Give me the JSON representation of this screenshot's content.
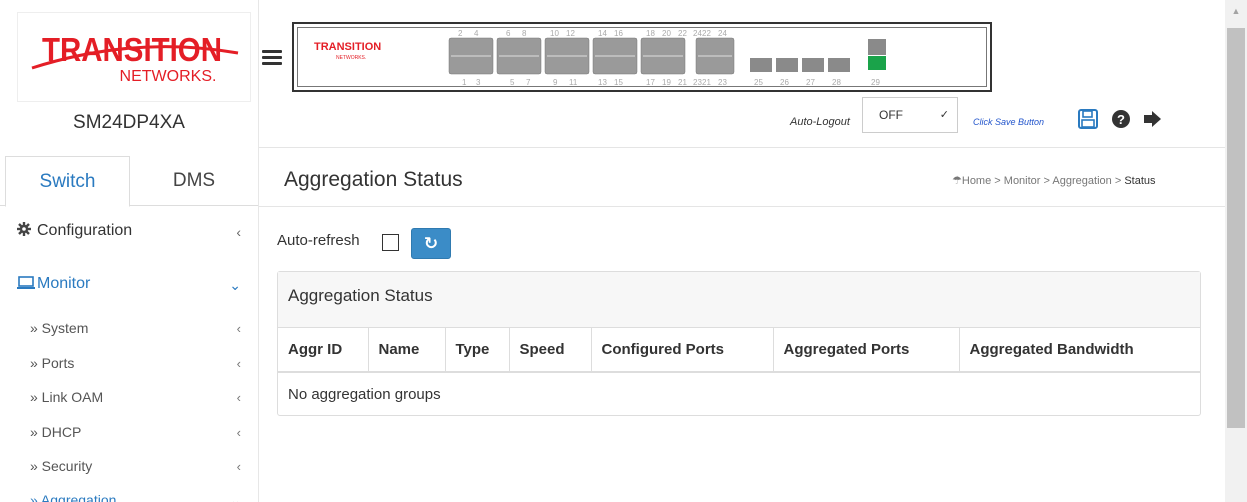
{
  "brand": {
    "logo_line1": "TRANSITION",
    "logo_line2": "NETWORKS.",
    "logo_color": "#e41e26"
  },
  "device": {
    "name": "SM24DP4XA"
  },
  "tabs": [
    {
      "label": "Switch",
      "active": true
    },
    {
      "label": "DMS",
      "active": false
    }
  ],
  "menu": {
    "configuration": {
      "label": "Configuration",
      "icon": "gear-icon"
    },
    "monitor": {
      "label": "Monitor",
      "icon": "monitor-icon",
      "color": "#2a7ac0"
    },
    "sub_items": [
      {
        "label": "» System"
      },
      {
        "label": "» Ports"
      },
      {
        "label": "» Link OAM"
      },
      {
        "label": "» DHCP"
      },
      {
        "label": "» Security"
      },
      {
        "label": "» Aggregation"
      }
    ]
  },
  "front_panel": {
    "top_port_numbers": [
      "2",
      "4",
      "6",
      "8",
      "10",
      "12",
      "14",
      "16",
      "18",
      "20",
      "22",
      "24",
      "22",
      "24"
    ],
    "bottom_port_numbers": [
      "1",
      "3",
      "5",
      "7",
      "9",
      "11",
      "13",
      "15",
      "17",
      "19",
      "21",
      "23",
      "21",
      "23",
      "25",
      "26",
      "27",
      "28",
      "29"
    ],
    "active_port_color": "#1aa34a"
  },
  "toolbar": {
    "autologout_label": "Auto-Logout",
    "autologout_value": "OFF",
    "click_save_label": "Click Save Button"
  },
  "page": {
    "title": "Aggregation Status",
    "breadcrumb": {
      "home": "Home",
      "sep": ">",
      "monitor": "Monitor",
      "aggregation": "Aggregation",
      "current": "Status"
    }
  },
  "controls": {
    "autorefresh_label": "Auto-refresh",
    "autorefresh_checked": false,
    "refresh_icon": "refresh-icon"
  },
  "status_panel": {
    "heading": "Aggregation Status",
    "columns": [
      "Aggr ID",
      "Name",
      "Type",
      "Speed",
      "Configured Ports",
      "Aggregated Ports",
      "Aggregated Bandwidth"
    ],
    "empty_message": "No aggregation groups"
  }
}
